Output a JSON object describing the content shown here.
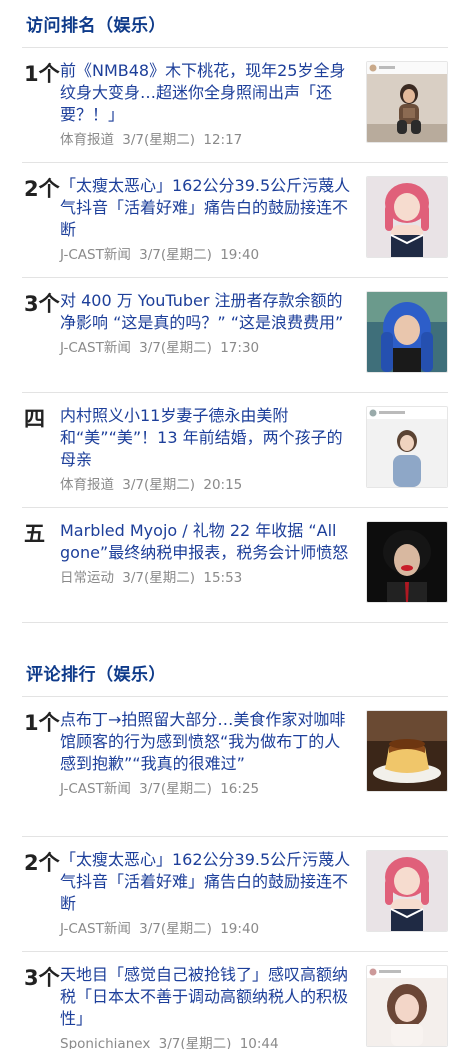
{
  "access_ranking": {
    "title": "访问排名（娱乐）",
    "items": [
      {
        "rank": "1个",
        "title": "前《NMB48》木下桃花，现年25岁全身纹身大变身…超迷你全身照闹出声「还要？！」",
        "source": "体育报道",
        "date": "3/7(星期二)",
        "time": "12:17",
        "thumb": "tattoo-woman-photo"
      },
      {
        "rank": "2个",
        "title": "「太瘦太恶心」162公分39.5公斤污蔑人气抖音「活着好难」痛告白的鼓励接连不断",
        "source": "J-CAST新闻",
        "date": "3/7(星期二)",
        "time": "19:40",
        "thumb": "pink-hair-woman-photo"
      },
      {
        "rank": "3个",
        "title": "对 400 万 YouTuber 注册者存款余额的净影响 “这是真的吗？” “这是浪费费用”",
        "source": "J-CAST新闻",
        "date": "3/7(星期二)",
        "time": "17:30",
        "thumb": "blue-hair-woman-photo"
      },
      {
        "rank": "四",
        "title": "内村照义小11岁妻子德永由美附和“美”“美”！13 年前结婚，两个孩子的母亲",
        "source": "体育报道",
        "date": "3/7(星期二)",
        "time": "20:15",
        "thumb": "announcer-instagram-photo"
      },
      {
        "rank": "五",
        "title": "Marbled Myojo / 礼物 22 年收据 “All gone”最终纳税申报表，税务会计师愤怒",
        "source": "日常运动",
        "date": "3/7(星期二)",
        "time": "15:53",
        "thumb": "red-lip-man-photo"
      }
    ]
  },
  "comment_ranking": {
    "title": "评论排行（娱乐）",
    "items": [
      {
        "rank": "1个",
        "title": "点布丁→拍照留大部分…美食作家对咖啡馆顾客的行为感到愤怒“我为做布丁的人感到抱歉”“我真的很难过”",
        "source": "J-CAST新闻",
        "date": "3/7(星期二)",
        "time": "16:25",
        "thumb": "pudding-photo"
      },
      {
        "rank": "2个",
        "title": "「太瘦太恶心」162公分39.5公斤污蔑人气抖音「活着好难」痛告白的鼓励接连不断",
        "source": "J-CAST新闻",
        "date": "3/7(星期二)",
        "time": "19:40",
        "thumb": "pink-hair-woman-photo"
      },
      {
        "rank": "3个",
        "title": "天地目「感觉自己被抢钱了」感叹高额纳税「日本太不善于调动高额纳税人的积极性」",
        "source": "Sponichianex",
        "date": "3/7(星期二)",
        "time": "10:44",
        "thumb": "woman-portrait-photo"
      }
    ]
  }
}
